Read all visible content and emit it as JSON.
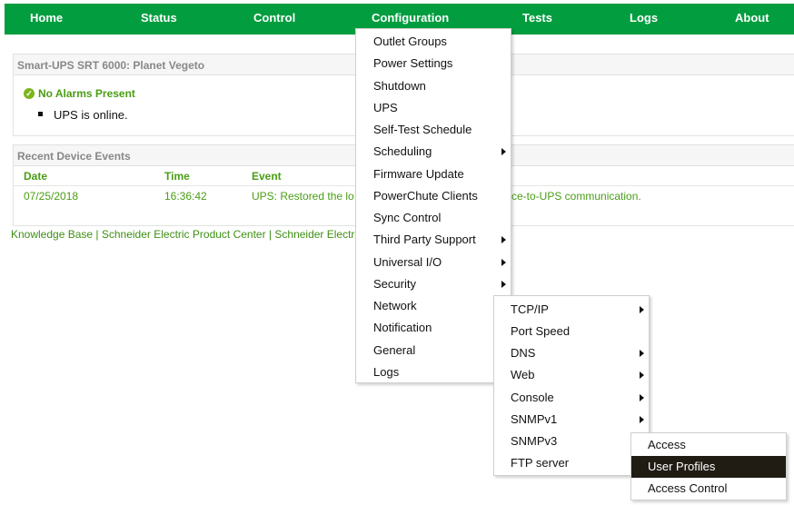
{
  "nav": {
    "home": "Home",
    "status": "Status",
    "control": "Control",
    "configuration": "Configuration",
    "tests": "Tests",
    "logs": "Logs",
    "about": "About"
  },
  "summary": {
    "title": "Smart-UPS SRT 6000: Planet Vegeto",
    "alarm_text": "No Alarms Present",
    "status_text": "UPS is online."
  },
  "events": {
    "title": "Recent Device Events",
    "headers": {
      "date": "Date",
      "time": "Time",
      "event": "Event"
    },
    "rows": [
      {
        "date": "07/25/2018",
        "time": "16:36:42",
        "event": "UPS: Restored the lo",
        "event_tail": "ce-to-UPS communication."
      }
    ]
  },
  "footer": {
    "text": "Knowledge Base | Schneider Electric Product Center | Schneider Electr"
  },
  "config_menu": [
    {
      "label": "Outlet Groups",
      "has_submenu": false
    },
    {
      "label": "Power Settings",
      "has_submenu": false
    },
    {
      "label": "Shutdown",
      "has_submenu": false
    },
    {
      "label": "UPS",
      "has_submenu": false
    },
    {
      "label": "Self-Test Schedule",
      "has_submenu": false
    },
    {
      "label": "Scheduling",
      "has_submenu": true
    },
    {
      "label": "Firmware Update",
      "has_submenu": false
    },
    {
      "label": "PowerChute Clients",
      "has_submenu": false
    },
    {
      "label": "Sync Control",
      "has_submenu": false
    },
    {
      "label": "Third Party Support",
      "has_submenu": true
    },
    {
      "label": "Universal I/O",
      "has_submenu": true
    },
    {
      "label": "Security",
      "has_submenu": true
    },
    {
      "label": "Network",
      "has_submenu": false
    },
    {
      "label": "Notification",
      "has_submenu": false
    },
    {
      "label": "General",
      "has_submenu": false
    },
    {
      "label": "Logs",
      "has_submenu": false
    }
  ],
  "network_menu": [
    {
      "label": "TCP/IP",
      "has_submenu": true
    },
    {
      "label": "Port Speed",
      "has_submenu": false
    },
    {
      "label": "DNS",
      "has_submenu": true
    },
    {
      "label": "Web",
      "has_submenu": true
    },
    {
      "label": "Console",
      "has_submenu": true
    },
    {
      "label": "SNMPv1",
      "has_submenu": true
    },
    {
      "label": "SNMPv3",
      "has_submenu": false
    },
    {
      "label": "FTP server",
      "has_submenu": false
    }
  ],
  "snmpv1_menu": [
    {
      "label": "Access",
      "selected": false
    },
    {
      "label": "User Profiles",
      "selected": true
    },
    {
      "label": "Access Control",
      "selected": false
    }
  ],
  "colors": {
    "nav_bg": "#019d3f",
    "accent_green": "#4a9d14",
    "highlight_bg": "#201c14"
  }
}
